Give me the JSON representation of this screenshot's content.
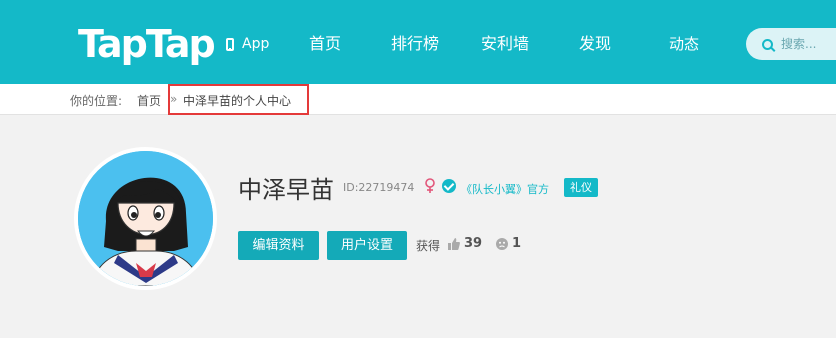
{
  "header": {
    "logo": "TapTap",
    "nav": {
      "app": "App",
      "home": "首页",
      "rank": "排行榜",
      "wall": "安利墙",
      "discover": "发现",
      "feed": "动态"
    },
    "search_placeholder": "搜索..."
  },
  "breadcrumb": {
    "label": "你的位置:",
    "home": "首页",
    "separator": "»",
    "current": "中泽早苗的个人中心"
  },
  "profile": {
    "name": "中泽早苗",
    "id_text": "ID:22719474",
    "gender": "female",
    "official_text": "《队长小翼》官方",
    "badge": "礼仪",
    "edit_button": "编辑资料",
    "settings_button": "用户设置",
    "stats_label": "获得",
    "likes": "39",
    "dislikes": "1"
  },
  "colors": {
    "brand": "#14b9c8",
    "highlight": "#e43a3a",
    "gender": "#e2567a"
  },
  "icons": [
    "phone-icon",
    "search-icon",
    "female-gender-icon",
    "verified-icon",
    "thumbs-up-icon",
    "face-icon"
  ]
}
